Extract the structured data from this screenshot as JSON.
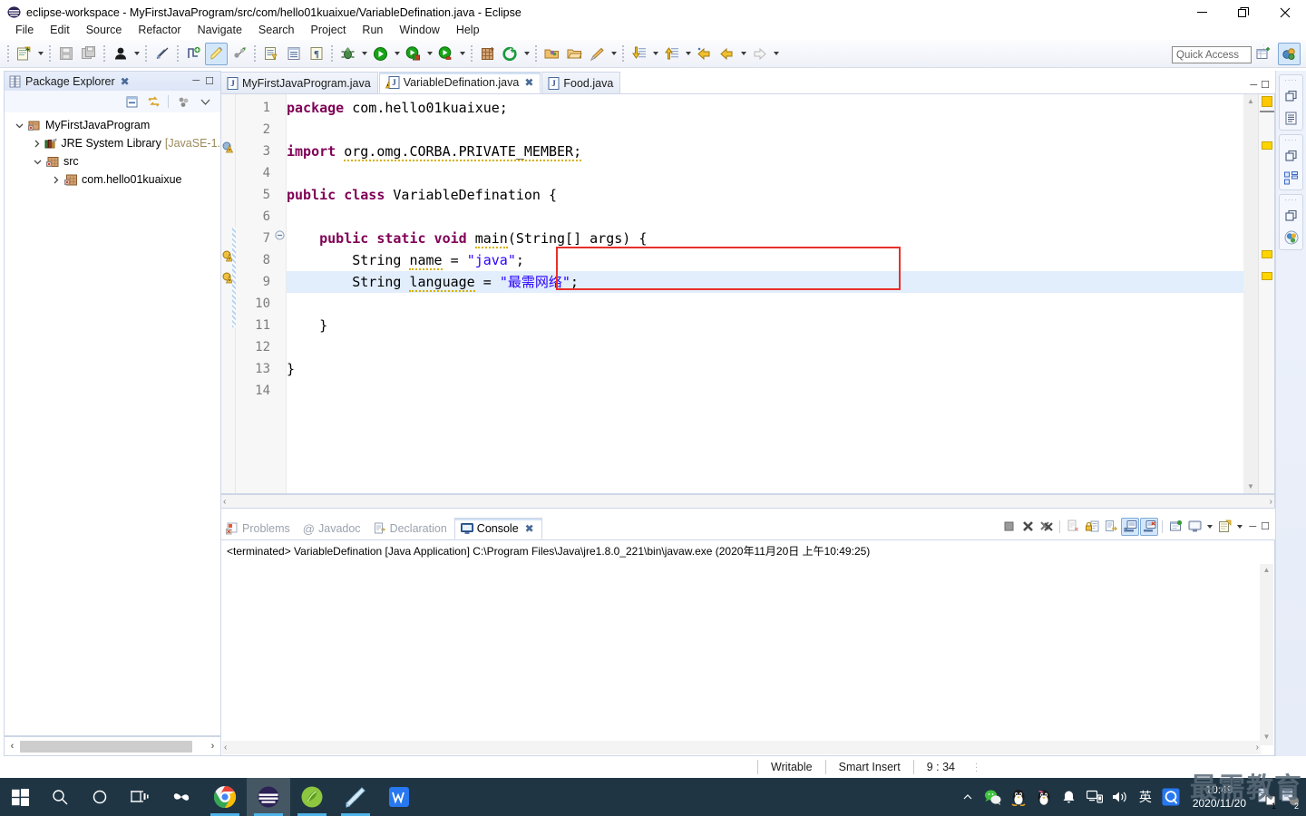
{
  "window": {
    "title": "eclipse-workspace - MyFirstJavaProgram/src/com/hello01kuaixue/VariableDefination.java - Eclipse",
    "minimize": "—",
    "maximize": "❐",
    "close": "✕"
  },
  "menubar": {
    "items": [
      "File",
      "Edit",
      "Source",
      "Refactor",
      "Navigate",
      "Search",
      "Project",
      "Run",
      "Window",
      "Help"
    ]
  },
  "toolbar": {
    "quick_access_placeholder": "Quick Access",
    "buttons": [
      "new-wizard-icon",
      "save-icon",
      "save-all-icon",
      "toggle-user-icon",
      "skip-breakpoints-icon",
      "new-java-class-icon",
      "toggle-mark-occurrences-icon",
      "link-icon",
      "open-type-icon",
      "open-task-icon",
      "pilcrow-icon",
      "debug-icon",
      "run-icon",
      "run-last-tool-icon",
      "external-tools-icon",
      "new-java-project-icon",
      "search-icon",
      "open-folder-icon",
      "open-resource-icon",
      "pencil-icon",
      "next-annotation-icon",
      "previous-annotation-icon",
      "back-icon",
      "forward-icon",
      "forward-disabled-icon"
    ]
  },
  "package_explorer": {
    "title": "Package Explorer",
    "close_glyph": "✖",
    "min_glyph": "─",
    "max_glyph": "❐",
    "tools": [
      "collapse-all-icon",
      "link-with-editor-icon",
      "view-menu-dots-icon",
      "view-menu-icon"
    ],
    "tree": [
      {
        "label": "MyFirstJavaProgram",
        "suffix": "",
        "indent": 0,
        "twisty": "expanded",
        "icon": "java-project-icon"
      },
      {
        "label": "JRE System Library",
        "suffix": "[JavaSE-1.",
        "indent": 1,
        "twisty": "collapsed",
        "icon": "library-icon"
      },
      {
        "label": "src",
        "suffix": "",
        "indent": 1,
        "twisty": "expanded",
        "icon": "source-folder-icon"
      },
      {
        "label": "com.hello01kuaixue",
        "suffix": "",
        "indent": 2,
        "twisty": "collapsed",
        "icon": "package-icon"
      }
    ],
    "scroll_left": "‹",
    "scroll_right": "›"
  },
  "editor": {
    "tabs": [
      {
        "label": "MyFirstJavaProgram.java",
        "selected": false,
        "closable": false,
        "warning": false
      },
      {
        "label": "VariableDefination.java",
        "selected": true,
        "closable": true,
        "warning": true
      },
      {
        "label": "Food.java",
        "selected": false,
        "closable": false,
        "warning": false
      }
    ],
    "minimize_glyph": "─",
    "maximize_glyph": "❐",
    "line_numbers": [
      "1",
      "2",
      "3",
      "4",
      "5",
      "6",
      "7",
      "8",
      "9",
      "10",
      "11",
      "12",
      "13",
      "14"
    ],
    "code_lines": [
      {
        "n": 1,
        "tokens": [
          {
            "t": "package",
            "c": "kw"
          },
          {
            "t": " com.hello01kuaixue;",
            "c": "plain"
          }
        ]
      },
      {
        "n": 2,
        "tokens": []
      },
      {
        "n": 3,
        "tokens": [
          {
            "t": "import",
            "c": "kw"
          },
          {
            "t": " ",
            "c": "plain"
          },
          {
            "t": "org.omg.CORBA.PRIVATE_MEMBER;",
            "c": "warnu"
          }
        ]
      },
      {
        "n": 4,
        "tokens": []
      },
      {
        "n": 5,
        "tokens": [
          {
            "t": "public class",
            "c": "kw"
          },
          {
            "t": " VariableDefination {",
            "c": "plain"
          }
        ]
      },
      {
        "n": 6,
        "tokens": []
      },
      {
        "n": 7,
        "tokens": [
          {
            "t": "    ",
            "c": "plain"
          },
          {
            "t": "public static void",
            "c": "kw"
          },
          {
            "t": " ",
            "c": "plain"
          },
          {
            "t": "main",
            "c": "warnu"
          },
          {
            "t": "(String[] ",
            "c": "plain"
          },
          {
            "t": "args",
            "c": "warnu"
          },
          {
            "t": ") {",
            "c": "plain"
          }
        ]
      },
      {
        "n": 8,
        "tokens": [
          {
            "t": "        String ",
            "c": "plain"
          },
          {
            "t": "name",
            "c": "warnu"
          },
          {
            "t": " = ",
            "c": "plain"
          },
          {
            "t": "\"java\"",
            "c": "str"
          },
          {
            "t": ";",
            "c": "plain"
          }
        ]
      },
      {
        "n": 9,
        "tokens": [
          {
            "t": "        String ",
            "c": "plain"
          },
          {
            "t": "language",
            "c": "warnu"
          },
          {
            "t": " = ",
            "c": "plain"
          },
          {
            "t": "\"最需网络\"",
            "c": "str"
          },
          {
            "t": ";",
            "c": "plain"
          }
        ]
      },
      {
        "n": 10,
        "tokens": []
      },
      {
        "n": 11,
        "tokens": [
          {
            "t": "    }",
            "c": "plain"
          }
        ]
      },
      {
        "n": 12,
        "tokens": []
      },
      {
        "n": 13,
        "tokens": [
          {
            "t": "}",
            "c": "plain"
          }
        ]
      },
      {
        "n": 14,
        "tokens": []
      }
    ],
    "highlight_line": 9,
    "annotation_markers": [
      3,
      8,
      9
    ],
    "fold_markers": [
      7
    ],
    "overview_markers_pct": [
      11,
      46,
      54
    ],
    "highlight_box": {
      "lines": [
        8,
        9
      ],
      "color": "#e8302a"
    },
    "scroll_left": "‹",
    "scroll_right": "›",
    "scroll_up": "▲",
    "scroll_down": "▼"
  },
  "console": {
    "tabs": [
      {
        "label": "Problems",
        "icon": "problems-icon",
        "selected": false,
        "closable": false
      },
      {
        "label": "Javadoc",
        "icon": "javadoc-icon",
        "selected": false,
        "closable": false
      },
      {
        "label": "Declaration",
        "icon": "declaration-icon",
        "selected": false,
        "closable": false
      },
      {
        "label": "Console",
        "icon": "console-icon",
        "selected": true,
        "closable": true
      }
    ],
    "close_glyph": "✖",
    "output": "<terminated> VariableDefination [Java Application] C:\\Program Files\\Java\\jre1.8.0_221\\bin\\javaw.exe (2020年11月20日 上午10:49:25)",
    "tools": [
      "terminate-icon",
      "remove-launch-icon",
      "remove-all-terminated-icon",
      "save-console-icon",
      "lock-scroll-icon",
      "clear-console-icon",
      "show-console-on-output-icon",
      "show-console-stderr-icon",
      "pin-console-icon",
      "display-selected-console-icon",
      "open-console-icon"
    ],
    "minimize_glyph": "─",
    "maximize_glyph": "❐"
  },
  "right_bar": {
    "groups": [
      {
        "restore": "restore-icon",
        "icon": "outline-view-icon"
      },
      {
        "restore": "restore-icon",
        "icon": "hierarchy-view-icon"
      },
      {
        "restore": "restore-icon",
        "icon": "java-perspective-icon"
      }
    ]
  },
  "statusbar": {
    "writable": "Writable",
    "insert_mode": "Smart Insert",
    "position": "9 : 34"
  },
  "taskbar": {
    "start": "start-icon",
    "search": "search-icon",
    "cortana": "cortana-icon",
    "taskview": "task-view-icon",
    "apps": [
      {
        "name": "snipaste-icon",
        "active": false,
        "running": false
      },
      {
        "name": "chrome-icon",
        "active": false,
        "running": true
      },
      {
        "name": "eclipse-icon",
        "active": true,
        "running": true
      },
      {
        "name": "mysql-workbench-icon",
        "active": false,
        "running": true
      },
      {
        "name": "notepad-icon",
        "active": false,
        "running": true
      },
      {
        "name": "wps-icon",
        "active": false,
        "running": false
      }
    ],
    "tray": [
      "chevron-up-icon",
      "wechat-icon",
      "qq-penguin-icon",
      "qq-penguin-pink-icon",
      "bell-icon",
      "network-icon",
      "volume-icon"
    ],
    "ime": "英",
    "qq_browser": "Q",
    "clock_time": "10:49",
    "clock_date": "2020/11/20",
    "badge1": "1",
    "badge2": "2",
    "watermark": "最需教育"
  }
}
